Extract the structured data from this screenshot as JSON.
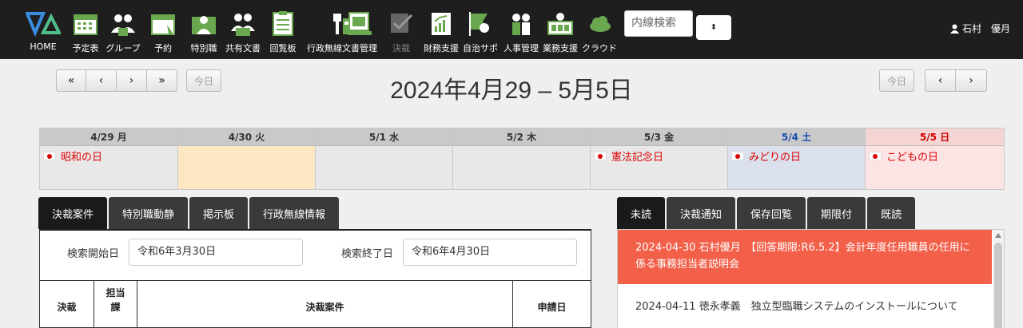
{
  "nav": {
    "items": [
      {
        "label": "HOME",
        "icon": "home-logo-icon"
      },
      {
        "label": "予定表",
        "icon": "calendar-icon"
      },
      {
        "label": "グループ",
        "icon": "group-icon"
      },
      {
        "label": "予約",
        "icon": "reservation-icon"
      },
      {
        "label": "特別職",
        "icon": "special-staff-icon"
      },
      {
        "label": "共有文書",
        "icon": "shared-docs-icon"
      },
      {
        "label": "回覧板",
        "icon": "circular-board-icon"
      },
      {
        "label": "行政無線文書管理",
        "icon": "radio-docs-icon"
      },
      {
        "label": "決裁",
        "icon": "approval-icon"
      },
      {
        "label": "財務支援",
        "icon": "finance-icon"
      },
      {
        "label": "自治サポ",
        "icon": "municipal-support-icon"
      },
      {
        "label": "人事管理",
        "icon": "hr-icon"
      },
      {
        "label": "業務支援",
        "icon": "business-support-icon"
      },
      {
        "label": "クラウド",
        "icon": "cloud-icon"
      }
    ],
    "search_placeholder": "内線検索",
    "select_glyph": "⬍",
    "user_name": "石村　優月"
  },
  "calendar": {
    "title": "2024年4月29 – 5月5日",
    "nav_left": [
      "«",
      "‹",
      "›",
      "»"
    ],
    "today_label": "今日",
    "nav_right": [
      "‹",
      "›"
    ],
    "days": [
      {
        "label": "4/29 月",
        "holiday": "昭和の日"
      },
      {
        "label": "4/30 火",
        "holiday": ""
      },
      {
        "label": "5/1 水",
        "holiday": ""
      },
      {
        "label": "5/2 木",
        "holiday": ""
      },
      {
        "label": "5/3 金",
        "holiday": "憲法記念日"
      },
      {
        "label": "5/4 土",
        "holiday": "みどりの日"
      },
      {
        "label": "5/5 日",
        "holiday": "こどもの日"
      }
    ],
    "colors": {
      "today": "#fde6c2",
      "saturday": "#dbe1ec",
      "sunday": "#fde4e4",
      "saturday_text": "#1a4fb0",
      "sunday_text": "#d00000"
    }
  },
  "left_tabs": [
    "決裁案件",
    "特別職動静",
    "掲示板",
    "行政無線情報"
  ],
  "right_tabs": [
    "未読",
    "決裁通知",
    "保存回覧",
    "期限付",
    "既読"
  ],
  "search": {
    "start_label": "検索開始日",
    "start_value": "令和6年3月30日",
    "end_label": "検索終了日",
    "end_value": "令和6年4月30日"
  },
  "table": {
    "headers": [
      "決裁",
      "担当\n課",
      "決裁案件",
      "申請日"
    ]
  },
  "notices": [
    {
      "text": "2024-04-30 石村優月　【回答期限:R6.5.2】会計年度任用職員の任用に係る事務担当者説明会",
      "alert": true
    },
    {
      "text": "2024-04-11 徳永孝義　独立型臨職システムのインストールについて",
      "alert": false
    }
  ]
}
